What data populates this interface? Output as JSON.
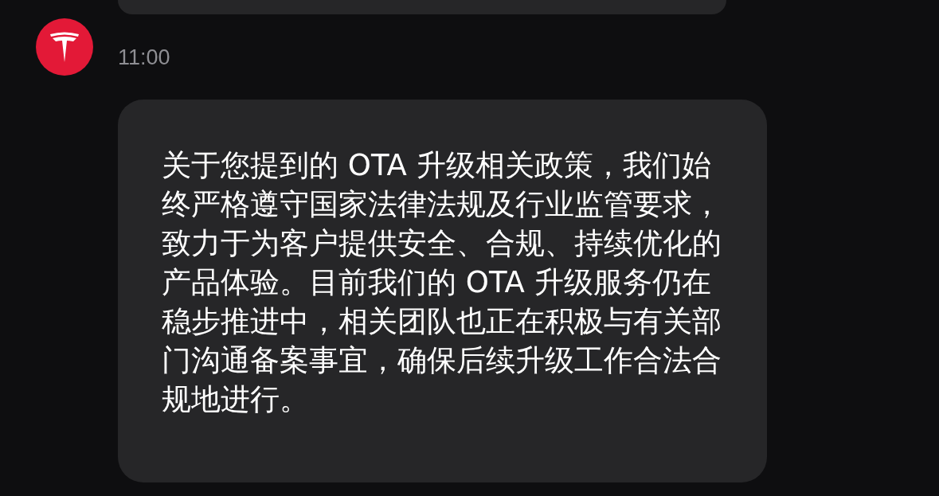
{
  "messages": [
    {
      "kind": "cut"
    },
    {
      "kind": "full",
      "time": "11:00",
      "text": "关于您提到的 OTA 升级相关政策，我们始终严格遵守国家法律法规及行业监管要求，致力于为客户提供安全、合规、持续优化的产品体验。目前我们的 OTA 升级服务仍在稳步推进中，相关团队也正在积极与有关部门沟通备案事宜，确保后续升级工作合法合规地进行。"
    }
  ]
}
